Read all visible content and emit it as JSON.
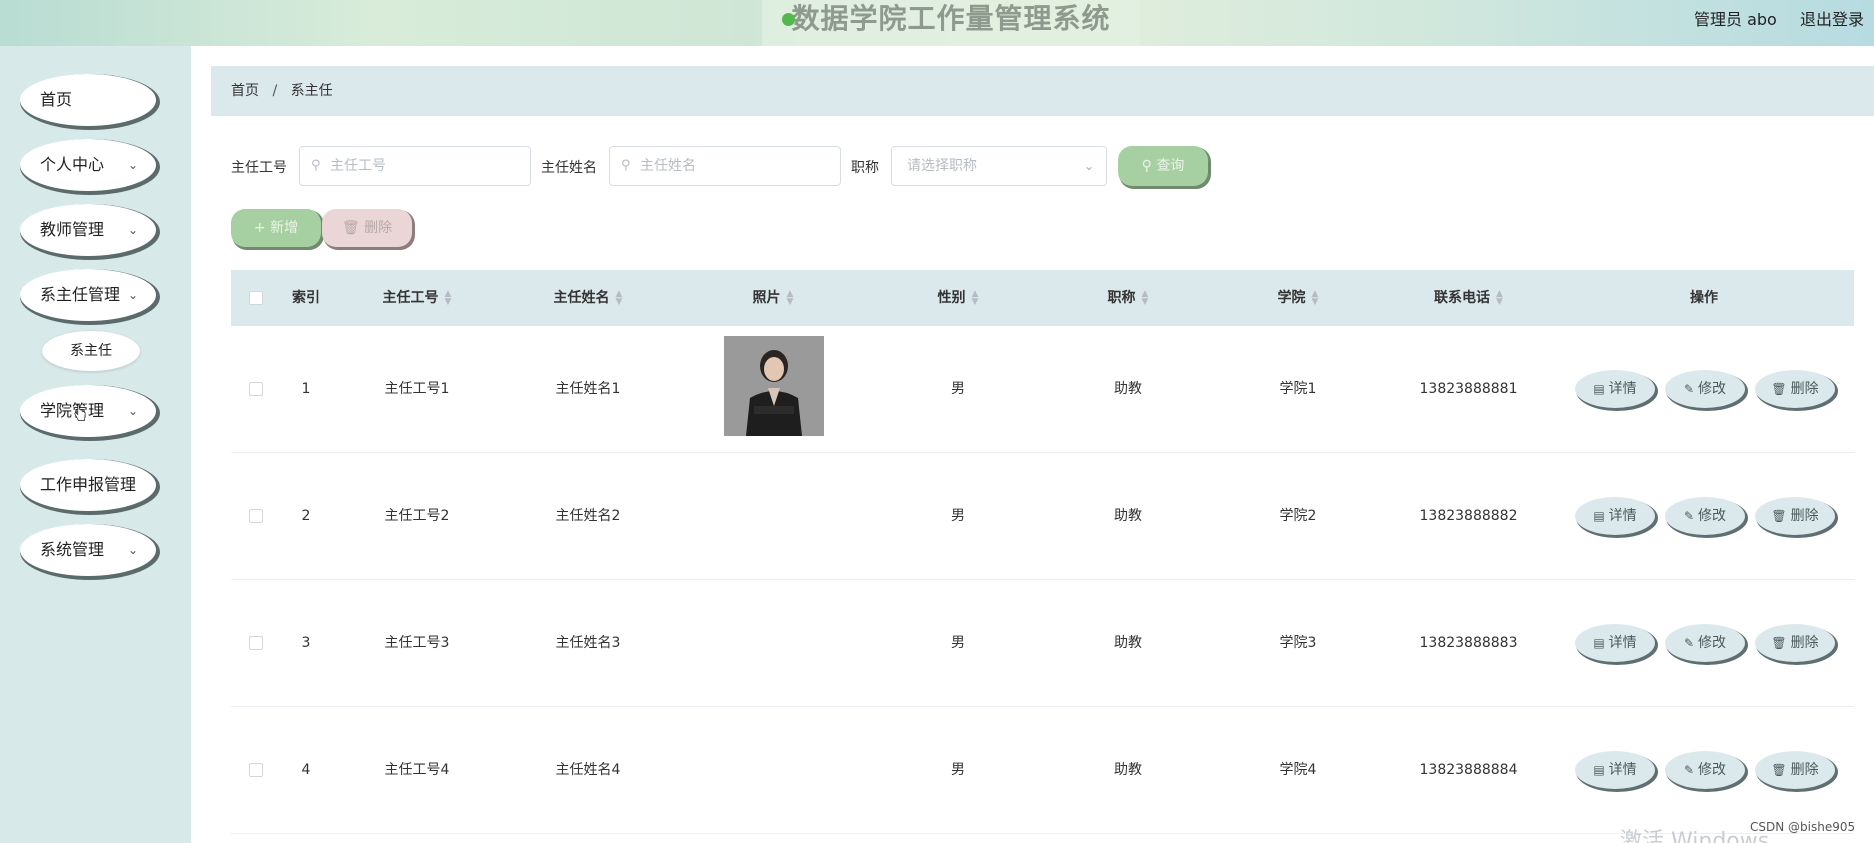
{
  "header": {
    "title": "数据学院工作量管理系统",
    "user_label": "管理员 abo",
    "logout_label": "退出登录"
  },
  "sidebar": {
    "items": [
      {
        "label": "首页",
        "has_children": false
      },
      {
        "label": "个人中心",
        "has_children": true
      },
      {
        "label": "教师管理",
        "has_children": true
      },
      {
        "label": "系主任管理",
        "has_children": true
      },
      {
        "label": "学院管理",
        "has_children": true
      },
      {
        "label": "工作申报管理",
        "has_children": true
      },
      {
        "label": "系统管理",
        "has_children": true
      }
    ],
    "sub_items": [
      {
        "label": "系主任"
      }
    ]
  },
  "breadcrumb": {
    "home": "首页",
    "separator": "/",
    "current": "系主任"
  },
  "search": {
    "id_label": "主任工号",
    "id_placeholder": "主任工号",
    "name_label": "主任姓名",
    "name_placeholder": "主任姓名",
    "title_label": "职称",
    "title_placeholder": "请选择职称",
    "query_label": "查询"
  },
  "actions": {
    "add_label": "新增",
    "delete_label": "删除"
  },
  "table": {
    "columns": [
      "索引",
      "主任工号",
      "主任姓名",
      "照片",
      "性别",
      "职称",
      "学院",
      "联系电话",
      "操作"
    ],
    "rows": [
      {
        "index": "1",
        "id": "主任工号1",
        "name": "主任姓名1",
        "has_photo": true,
        "gender": "男",
        "title": "助教",
        "college": "学院1",
        "phone": "13823888881"
      },
      {
        "index": "2",
        "id": "主任工号2",
        "name": "主任姓名2",
        "has_photo": false,
        "gender": "男",
        "title": "助教",
        "college": "学院2",
        "phone": "13823888882"
      },
      {
        "index": "3",
        "id": "主任工号3",
        "name": "主任姓名3",
        "has_photo": false,
        "gender": "男",
        "title": "助教",
        "college": "学院3",
        "phone": "13823888883"
      },
      {
        "index": "4",
        "id": "主任工号4",
        "name": "主任姓名4",
        "has_photo": false,
        "gender": "男",
        "title": "助教",
        "college": "学院4",
        "phone": "13823888884"
      }
    ],
    "row_actions": {
      "detail": "详情",
      "edit": "修改",
      "delete": "删除"
    }
  },
  "watermark": {
    "activate": "激活 Windows",
    "csdn": "CSDN @bishe905"
  }
}
